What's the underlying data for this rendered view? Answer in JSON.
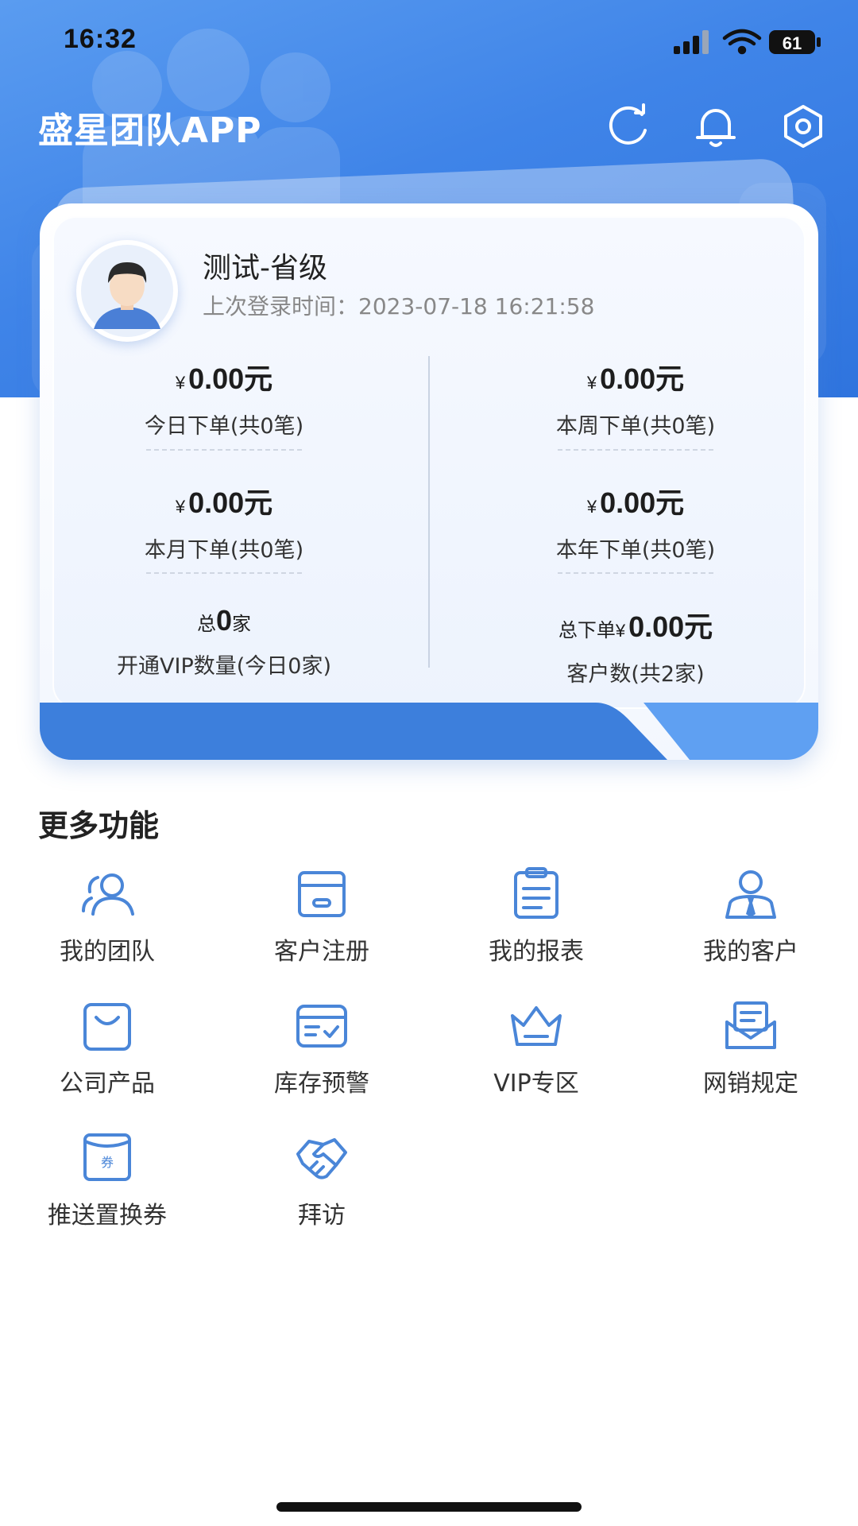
{
  "status_bar": {
    "time": "16:32",
    "battery": "61"
  },
  "header": {
    "title": "盛星团队APP",
    "icons": [
      "refresh-icon",
      "bell-icon",
      "settings-hex-icon"
    ]
  },
  "profile": {
    "name": "测试-省级",
    "last_login_label": "上次登录时间：",
    "last_login_value": "2023-07-18 16:21:58"
  },
  "stats": {
    "currency": "¥",
    "today": {
      "value": "0.00元",
      "label": "今日下单(共0笔)"
    },
    "week": {
      "value": "0.00元",
      "label": "本周下单(共0笔)"
    },
    "month": {
      "value": "0.00元",
      "label": "本月下单(共0笔)"
    },
    "year": {
      "value": "0.00元",
      "label": "本年下单(共0笔)"
    },
    "vip": {
      "prefix": "总",
      "value": "0",
      "suffix": "家",
      "label": "开通VIP数量(今日0家)"
    },
    "customers": {
      "prefix": "总下单",
      "value": "0.00元",
      "label": "客户数(共2家)"
    }
  },
  "more": {
    "title": "更多功能",
    "items": [
      {
        "label": "我的团队",
        "icon": "team-icon"
      },
      {
        "label": "客户注册",
        "icon": "register-card-icon"
      },
      {
        "label": "我的报表",
        "icon": "report-clipboard-icon"
      },
      {
        "label": "我的客户",
        "icon": "customer-person-icon"
      },
      {
        "label": "公司产品",
        "icon": "shopping-bag-icon"
      },
      {
        "label": "库存预警",
        "icon": "inventory-check-icon"
      },
      {
        "label": "VIP专区",
        "icon": "crown-icon"
      },
      {
        "label": "网销规定",
        "icon": "envelope-doc-icon"
      },
      {
        "label": "推送置换券",
        "icon": "coupon-icon",
        "icon_text": "券"
      },
      {
        "label": "拜访",
        "icon": "handshake-icon"
      }
    ]
  },
  "colors": {
    "primary": "#3f84e8",
    "icon_blue": "#4a86d8",
    "background": "#ffffff"
  }
}
